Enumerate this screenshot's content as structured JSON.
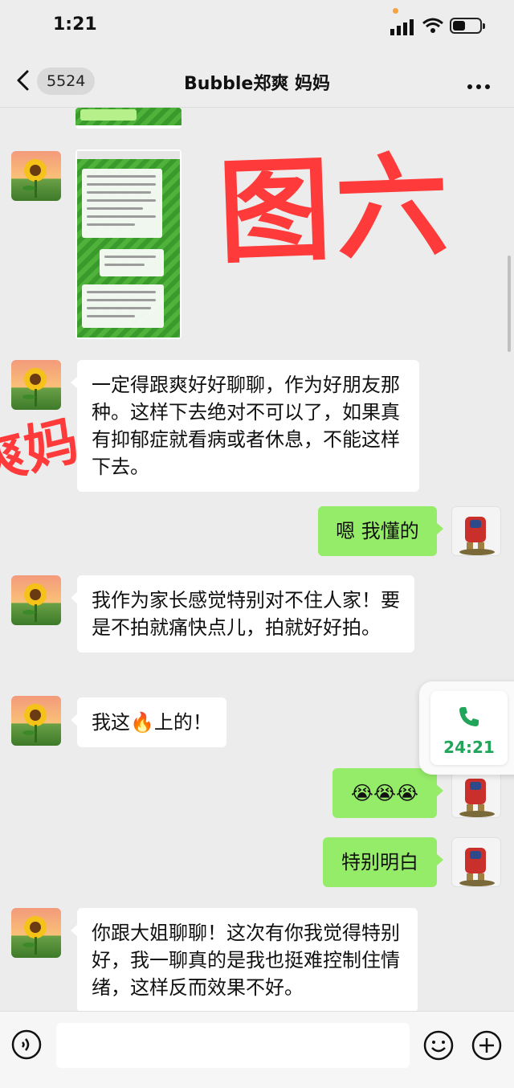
{
  "status_bar": {
    "time": "1:21"
  },
  "header": {
    "unread_count": "5524",
    "title": "Bubble郑爽 妈妈"
  },
  "overlays": {
    "image_stamp": "图六",
    "side_stamp": "爽妈"
  },
  "messages": [
    {
      "side": "left",
      "type": "image"
    },
    {
      "side": "left",
      "type": "image"
    },
    {
      "side": "left",
      "type": "text",
      "text": "一定得跟爽好好聊聊，作为好朋友那种。这样下去绝对不可以了，如果真有抑郁症就看病或者休息，不能这样下去。"
    },
    {
      "side": "right",
      "type": "text",
      "text": "嗯 我懂的"
    },
    {
      "side": "left",
      "type": "text",
      "text": "我作为家长感觉特别对不住人家！要是不拍就痛快点儿，拍就好好拍。"
    },
    {
      "side": "left",
      "type": "text",
      "text": "我这🔥上的！"
    },
    {
      "side": "right",
      "type": "text",
      "text": "😭😭😭"
    },
    {
      "side": "right",
      "type": "text",
      "text": "特别明白"
    },
    {
      "side": "left",
      "type": "text",
      "text": "你跟大姐聊聊！这次有你我觉得特别好，我一聊真的是我也挺难控制住情绪，这样反而效果不好。"
    }
  ],
  "call_float": {
    "duration": "24:21"
  },
  "input": {
    "placeholder": ""
  },
  "icons": [
    "back-arrow-icon",
    "more-icon",
    "phone-icon",
    "voice-icon",
    "emoji-icon",
    "plus-icon"
  ],
  "colors": {
    "sent_bubble": "#95ec69",
    "received_bubble": "#ffffff",
    "background": "#ececec",
    "stamp_red": "#ff3a3a",
    "call_green": "#21a55a"
  }
}
